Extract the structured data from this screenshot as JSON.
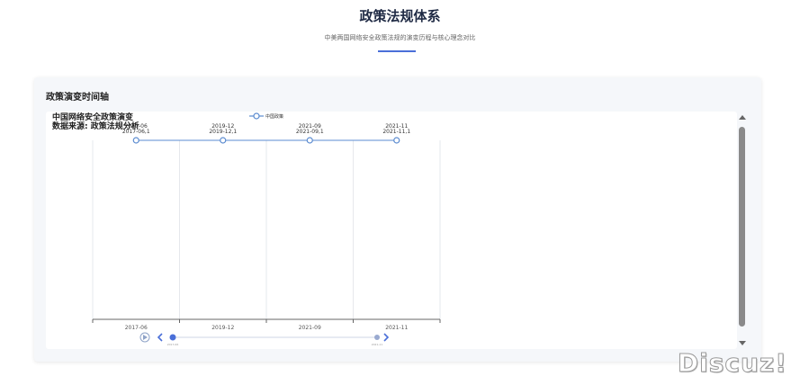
{
  "header": {
    "title": "政策法规体系",
    "subtitle": "中美两国网络安全政策法规的演变历程与核心理念对比"
  },
  "card": {
    "title": "政策演变时间轴"
  },
  "chart_title": "中国网络安全政策演变",
  "chart_source": "数据来源: 政策法规分析",
  "chart_data": {
    "type": "line",
    "categories": [
      "2017-06",
      "2019-12",
      "2021-09",
      "2021-11"
    ],
    "series": [
      {
        "name": "中国政策",
        "values": [
          1,
          1,
          1,
          1
        ],
        "point_labels": [
          "2017-06,1",
          "2019-12,1",
          "2021-09,1",
          "2021-11,1"
        ],
        "color": "#5b8bd0"
      }
    ],
    "top_labels": [
      "2017-06",
      "2019-12",
      "2021-09",
      "2021-11"
    ],
    "legend": "top-center",
    "grid": true
  },
  "slider": {
    "start_label": "2017-06",
    "end_label": "2021-11",
    "play_icon": "play-icon",
    "prev_icon": "chevron-left-icon",
    "next_icon": "chevron-right-icon"
  },
  "watermark": "Discuz!",
  "colors": {
    "accent": "#4a6fd8",
    "series": "#5b8bd0",
    "thumb": "#8a8a8a"
  }
}
